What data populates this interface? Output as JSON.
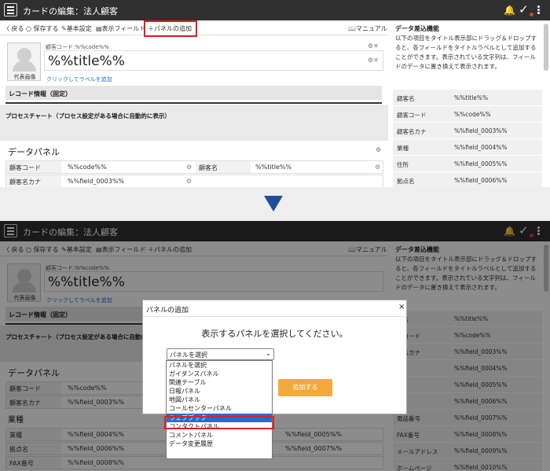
{
  "app": {
    "title": "カードの編集：法人顧客"
  },
  "toolbar": {
    "back": "〈 戻る",
    "save": "保存する",
    "basic": "基本設定",
    "fields": "表示フィールド",
    "add_panel": "パネルの追加",
    "manual": "マニュアル"
  },
  "card": {
    "code_label": "顧客コード:%%code%%",
    "avatar_label": "代表画像",
    "title_value": "%%title%%",
    "label_link": "クリックしてラベルを追加",
    "record_info": "レコード情報（固定）",
    "process_chart": "プロセスチャート（プロセス設定がある場合に自動的に表示）"
  },
  "data_panel": {
    "title": "データパネル",
    "rows_top": [
      {
        "k1": "顧客コード",
        "v1": "%%code%%",
        "k2": "顧客名",
        "v2": "%%title%%"
      },
      {
        "k1": "顧客名カナ",
        "v1": "%%field_0003%%"
      }
    ],
    "industry": "業種",
    "rows_bottom": [
      {
        "k1": "業種",
        "v1": "%%field_0004%%",
        "v2": "%%field_0005%%"
      },
      {
        "k1": "拠点名",
        "v1": "%%field_0006%%",
        "v2": "%%field_0007%%"
      },
      {
        "k1": "FAX番号",
        "v1": "%%field_0008%%"
      }
    ]
  },
  "sidebar": {
    "heading": "データ差込機能",
    "description": "以下の項目をタイトル表示部にドラッグ＆ドロップすると、各フィールドをタイトルラベルとして追加することができます。表示されている文字列は、フィールドのデータに置き換えて表示されます。",
    "rows_top": [
      {
        "k": "顧客名",
        "v": "%%title%%"
      },
      {
        "k": "顧客コード",
        "v": "%%code%%"
      },
      {
        "k": "顧客名カナ",
        "v": "%%field_0003%%"
      },
      {
        "k": "業種",
        "v": "%%field_0004%%"
      },
      {
        "k": "住所",
        "v": "%%field_0005%%"
      },
      {
        "k": "拠点名",
        "v": "%%field_0006%%"
      }
    ],
    "rows_bottom": [
      {
        "k": "客名",
        "v": "%%title%%"
      },
      {
        "k": "客コード",
        "v": "%%code%%"
      },
      {
        "k": "客名カナ",
        "v": "%%field_0003%%"
      },
      {
        "k": "",
        "v": "%%field_0004%%"
      },
      {
        "k": "",
        "v": "%%field_0005%%"
      },
      {
        "k": "",
        "v": "%%field_0006%%"
      },
      {
        "k": "電話番号",
        "v": "%%field_0007%%"
      },
      {
        "k": "FAX番号",
        "v": "%%field_0008%%"
      },
      {
        "k": "メールアドレス",
        "v": "%%field_0009%%"
      },
      {
        "k": "ホームページ",
        "v": "%%field_0010%%"
      }
    ]
  },
  "modal": {
    "title": "パネルの追加",
    "close": "×",
    "prompt": "表示するパネルを選択してください。",
    "select_value": "パネルを選択",
    "add_button": "追加する",
    "options": [
      "パネルを選択",
      "ガイダンスパネル",
      "関連テーブル",
      "日報パネル",
      "地図パネル",
      "コールセンターパネル",
      "ウェブブック",
      "コンタクトパネル",
      "コメントパネル",
      "データ変更履歴"
    ],
    "highlighted": "ウェブブック"
  },
  "colors": {
    "header": "#303030",
    "highlight_box": "#e02020",
    "arrow": "#1f4f96",
    "select_highlight": "#1e6fd0",
    "add_button": "#f5a83a"
  }
}
